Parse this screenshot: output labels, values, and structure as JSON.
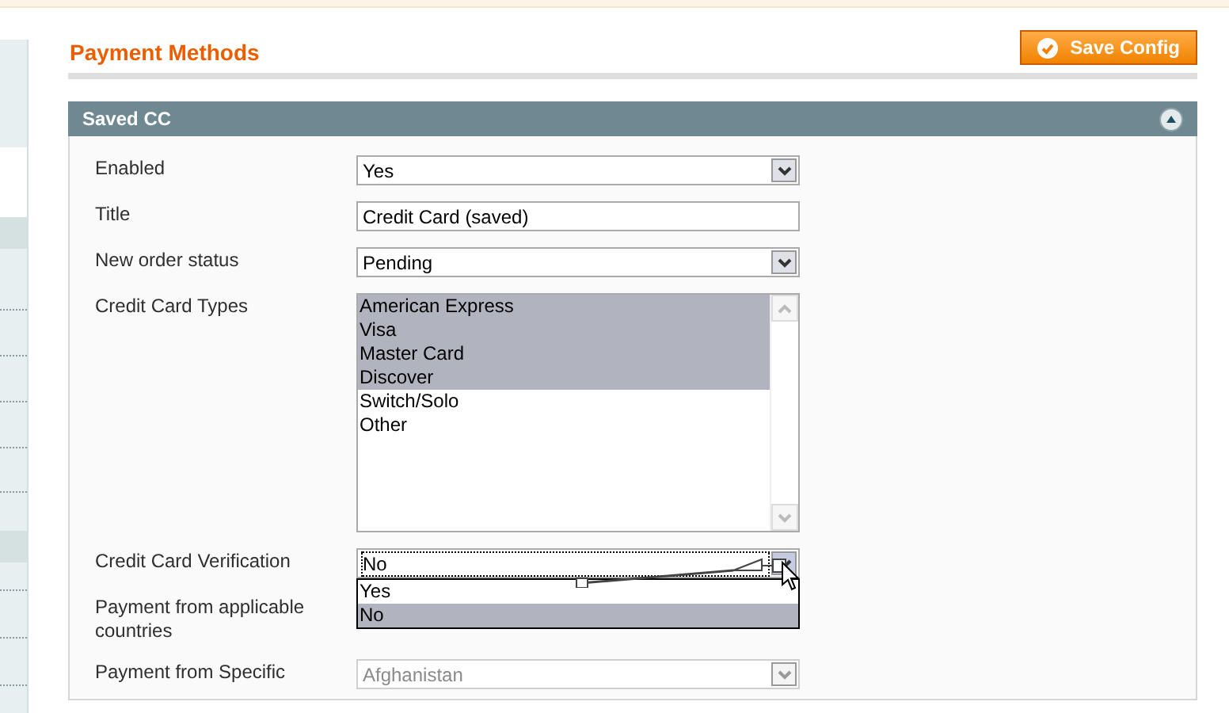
{
  "page": {
    "title": "Payment Methods",
    "save_button": "Save Config"
  },
  "section": {
    "title": "Saved CC",
    "expanded": true,
    "fields": [
      {
        "kind": "select",
        "label": "Enabled",
        "value": "Yes",
        "disabled": false
      },
      {
        "kind": "text",
        "label": "Title",
        "value": "Credit Card (saved)",
        "disabled": false
      },
      {
        "kind": "select",
        "label": "New order status",
        "value": "Pending",
        "disabled": false
      },
      {
        "kind": "multiselect",
        "label": "Credit Card Types",
        "disabled": false,
        "options": [
          {
            "label": "American Express",
            "selected": true
          },
          {
            "label": "Visa",
            "selected": true
          },
          {
            "label": "Master Card",
            "selected": true
          },
          {
            "label": "Discover",
            "selected": true
          },
          {
            "label": "Switch/Solo",
            "selected": false
          },
          {
            "label": "Other",
            "selected": false
          }
        ]
      },
      {
        "kind": "open_select",
        "label": "Credit Card Verification",
        "value": "No",
        "disabled": false,
        "options": [
          {
            "label": "Yes",
            "selected": false
          },
          {
            "label": "No",
            "selected": true
          }
        ]
      },
      {
        "kind": "covered",
        "label": "Payment from applicable countries"
      },
      {
        "kind": "select",
        "label": "Payment from Specific",
        "value": "Afghanistan",
        "disabled": true
      }
    ]
  }
}
